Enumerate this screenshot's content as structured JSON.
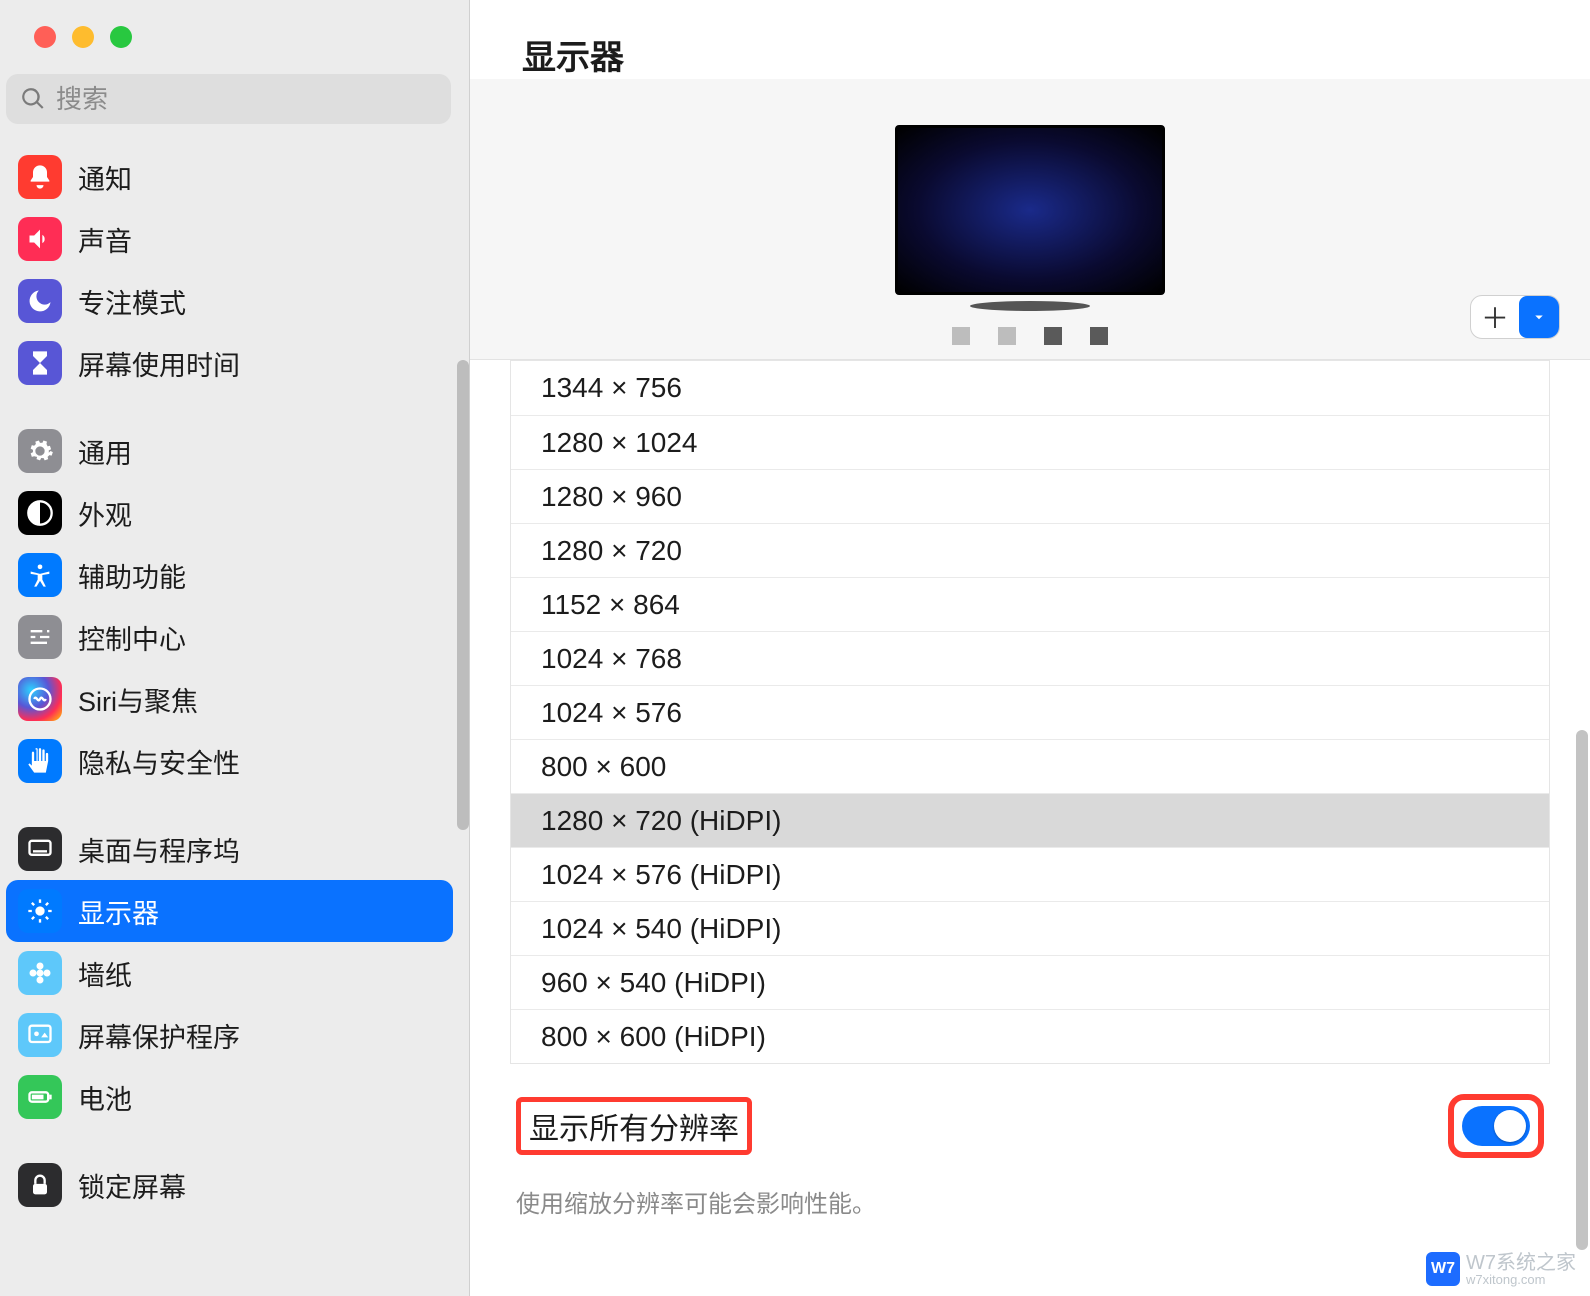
{
  "search": {
    "placeholder": "搜索"
  },
  "sidebar": {
    "groups": [
      {
        "items": [
          {
            "key": "notifications",
            "label": "通知",
            "bg": "bg-red",
            "icon": "bell"
          },
          {
            "key": "sound",
            "label": "声音",
            "bg": "bg-pink",
            "icon": "speaker"
          },
          {
            "key": "focus",
            "label": "专注模式",
            "bg": "bg-indigo",
            "icon": "moon"
          },
          {
            "key": "screentime",
            "label": "屏幕使用时间",
            "bg": "bg-indigo",
            "icon": "hourglass"
          }
        ]
      },
      {
        "items": [
          {
            "key": "general",
            "label": "通用",
            "bg": "bg-gray",
            "icon": "gear"
          },
          {
            "key": "appearance",
            "label": "外观",
            "bg": "bg-black",
            "icon": "contrast"
          },
          {
            "key": "accessibility",
            "label": "辅助功能",
            "bg": "bg-blue",
            "icon": "accessibility"
          },
          {
            "key": "controlcenter",
            "label": "控制中心",
            "bg": "bg-gray",
            "icon": "sliders"
          },
          {
            "key": "siri",
            "label": "Siri与聚焦",
            "bg": "bg-siri",
            "icon": "siri"
          },
          {
            "key": "privacy",
            "label": "隐私与安全性",
            "bg": "bg-blue",
            "icon": "hand"
          }
        ]
      },
      {
        "items": [
          {
            "key": "desktop",
            "label": "桌面与程序坞",
            "bg": "bg-dark",
            "icon": "dock"
          },
          {
            "key": "displays",
            "label": "显示器",
            "bg": "bg-blue",
            "icon": "brightness",
            "selected": true
          },
          {
            "key": "wallpaper",
            "label": "墙纸",
            "bg": "bg-teal",
            "icon": "flower"
          },
          {
            "key": "screensaver",
            "label": "屏幕保护程序",
            "bg": "bg-teal",
            "icon": "screensaver"
          },
          {
            "key": "battery",
            "label": "电池",
            "bg": "bg-green",
            "icon": "battery"
          }
        ]
      },
      {
        "items": [
          {
            "key": "lockscreen",
            "label": "锁定屏幕",
            "bg": "bg-dark",
            "icon": "lock"
          }
        ]
      }
    ]
  },
  "main": {
    "title": "显示器",
    "resolutions": [
      {
        "label": "1344 × 756"
      },
      {
        "label": "1280 × 1024"
      },
      {
        "label": "1280 × 960"
      },
      {
        "label": "1280 × 720"
      },
      {
        "label": "1152 × 864"
      },
      {
        "label": "1024 × 768"
      },
      {
        "label": "1024 × 576"
      },
      {
        "label": "800 × 600"
      },
      {
        "label": "1280 × 720 (HiDPI)",
        "selected": true
      },
      {
        "label": "1024 × 576 (HiDPI)"
      },
      {
        "label": "1024 × 540 (HiDPI)"
      },
      {
        "label": "960 × 540 (HiDPI)"
      },
      {
        "label": "800 × 600 (HiDPI)"
      }
    ],
    "show_all_label": "显示所有分辨率",
    "show_all_on": true,
    "hint": "使用缩放分辨率可能会影响性能。"
  },
  "watermark": {
    "logo": "W7",
    "text": "W7系统之家",
    "sub": "w7xitong.com"
  }
}
